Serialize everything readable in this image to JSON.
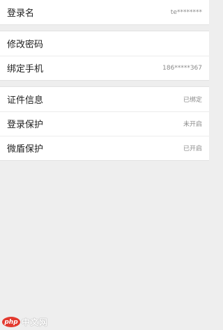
{
  "account_section": {
    "login_name": {
      "label": "登录名",
      "value": "te********"
    }
  },
  "security_section": {
    "change_password": {
      "label": "修改密码"
    },
    "bind_phone": {
      "label": "绑定手机",
      "value": "186*****367"
    }
  },
  "verification_section": {
    "id_info": {
      "label": "证件信息",
      "status": "已绑定"
    },
    "login_protect": {
      "label": "登录保护",
      "status": "未开启"
    },
    "weidun_protect": {
      "label": "微盾保护",
      "status": "已开启"
    }
  },
  "watermark": {
    "badge_text": "php",
    "text": "中文网"
  }
}
